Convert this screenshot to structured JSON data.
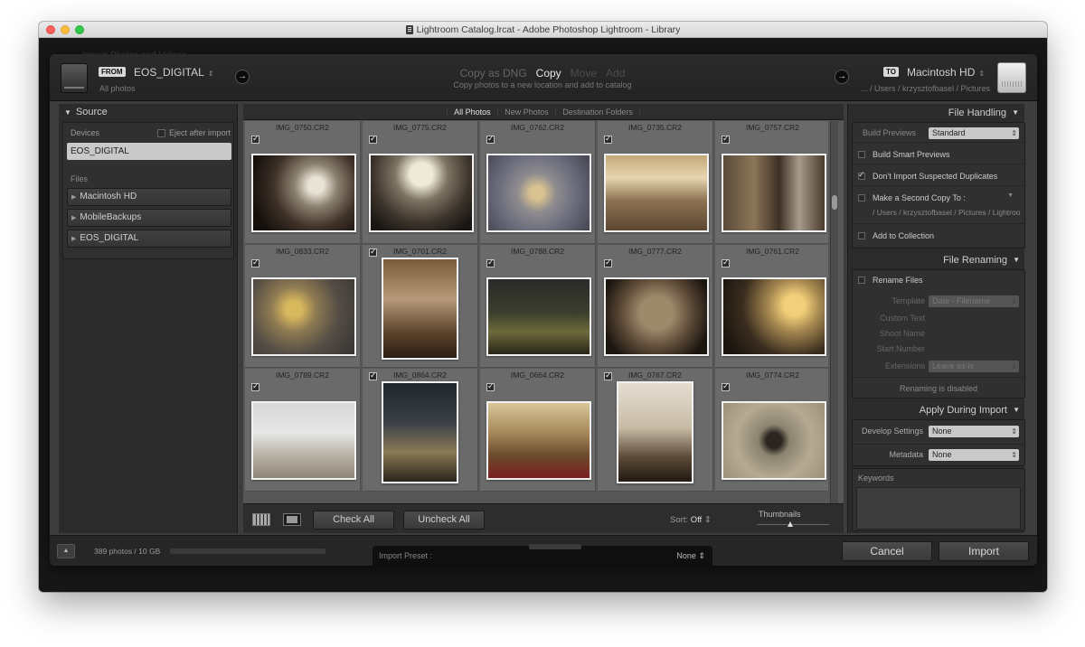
{
  "window": {
    "title": "Lightroom Catalog.lrcat - Adobe Photoshop Lightroom - Library"
  },
  "background": {
    "hint_text": "Import Photos and Videos"
  },
  "header": {
    "from_tag": "FROM",
    "from_name": "EOS_DIGITAL",
    "from_updown": "⇕",
    "from_sub": "All photos",
    "modes": [
      {
        "label": "Copy as DNG",
        "state": "inactive"
      },
      {
        "label": "Copy",
        "state": "active"
      },
      {
        "label": "Move",
        "state": "disabled"
      },
      {
        "label": "Add",
        "state": "disabled"
      }
    ],
    "mode_sub": "Copy photos to a new location and add to catalog",
    "to_tag": "TO",
    "to_name": "Macintosh HD",
    "to_updown": "⇕",
    "to_sub": "... / Users / krzysztofbasel / Pictures",
    "go_icon": "→"
  },
  "source": {
    "title": "Source",
    "devices_label": "Devices",
    "eject_label": "Eject after import",
    "selected_device": "EOS_DIGITAL",
    "files_label": "Files",
    "files": [
      "Macintosh HD",
      "MobileBackups",
      "EOS_DIGITAL"
    ]
  },
  "filter": {
    "all": "All Photos",
    "new": "New Photos",
    "dest": "Destination Folders"
  },
  "grid": {
    "cells": [
      {
        "name": "IMG_0750.CR2",
        "orient": "land",
        "img": 0
      },
      {
        "name": "IMG_0775.CR2",
        "orient": "land",
        "img": 1
      },
      {
        "name": "IMG_0762.CR2",
        "orient": "land",
        "img": 2
      },
      {
        "name": "IMG_0735.CR2",
        "orient": "land",
        "img": 3
      },
      {
        "name": "IMG_0757.CR2",
        "orient": "land",
        "img": 4
      },
      {
        "name": "IMG_0833.CR2",
        "orient": "land",
        "img": 5
      },
      {
        "name": "IMG_0701.CR2",
        "orient": "port",
        "img": 6
      },
      {
        "name": "IMG_0788.CR2",
        "orient": "land",
        "img": 7
      },
      {
        "name": "IMG_0777.CR2",
        "orient": "land",
        "img": 8
      },
      {
        "name": "IMG_0761.CR2",
        "orient": "land",
        "img": 9
      },
      {
        "name": "IMG_0789.CR2",
        "orient": "land",
        "img": 10
      },
      {
        "name": "IMG_0864.CR2",
        "orient": "port",
        "img": 11
      },
      {
        "name": "IMG_0664.CR2",
        "orient": "land",
        "img": 12
      },
      {
        "name": "IMG_0767.CR2",
        "orient": "port",
        "img": 13
      },
      {
        "name": "IMG_0774.CR2",
        "orient": "land",
        "img": 14
      }
    ]
  },
  "grid_toolbar": {
    "check_all": "Check All",
    "uncheck_all": "Uncheck All",
    "sort_label": "Sort:",
    "sort_value": "Off",
    "thumbnails_label": "Thumbnails"
  },
  "file_handling": {
    "title": "File Handling",
    "build_previews_label": "Build Previews",
    "build_previews_value": "Standard",
    "smart_previews": "Build Smart Previews",
    "no_duplicates": "Don't Import Suspected Duplicates",
    "second_copy": "Make a Second Copy To :",
    "second_copy_path": "/ Users / krzysztofbasel / Pictures / Lightroo",
    "add_collection": "Add to Collection"
  },
  "file_renaming": {
    "title": "File Renaming",
    "rename_files": "Rename Files",
    "template_label": "Template",
    "template_value": "Date - Filename",
    "custom_text": "Custom Text",
    "shoot_name": "Shoot Name",
    "start_number": "Start Number",
    "extensions_label": "Extensions",
    "extensions_value": "Leave as-is",
    "disabled_note": "Renaming is disabled"
  },
  "apply_during_import": {
    "title": "Apply During Import",
    "develop_label": "Develop Settings",
    "develop_value": "None",
    "metadata_label": "Metadata",
    "metadata_value": "None",
    "keywords_label": "Keywords"
  },
  "footer": {
    "count": "389 photos / 10 GB",
    "preset_label": "Import Preset :",
    "preset_value": "None",
    "preset_updown": "⇕",
    "cancel": "Cancel",
    "import": "Import"
  }
}
